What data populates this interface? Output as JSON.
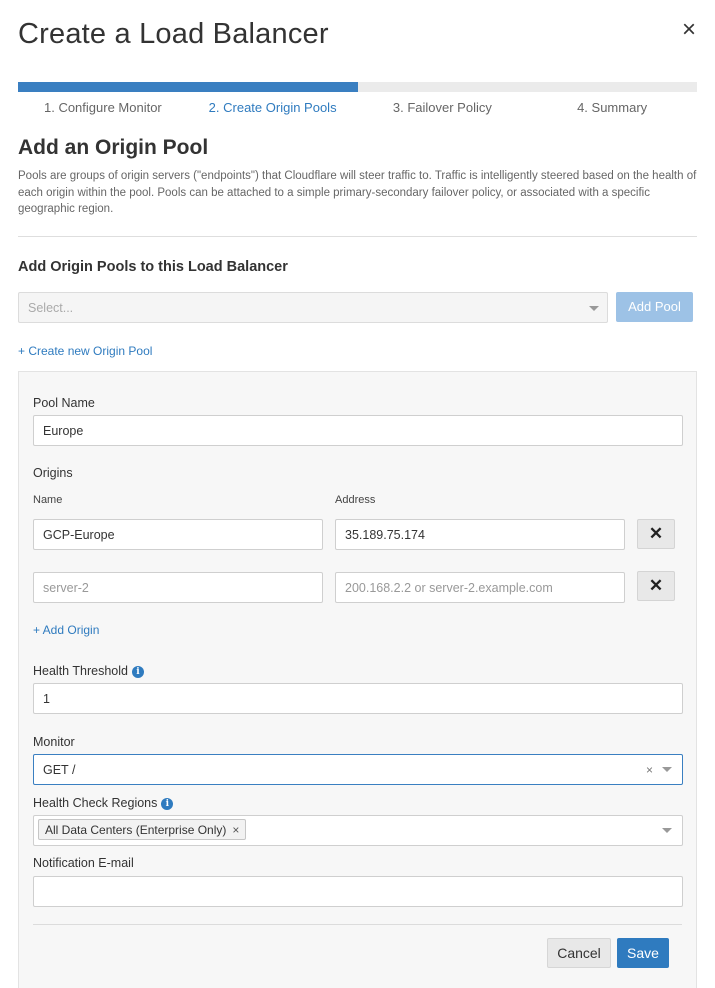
{
  "modal": {
    "title": "Create a Load Balancer",
    "close_glyph": "×"
  },
  "wizard": {
    "progress_fraction": 0.5,
    "steps": [
      {
        "label": "1. Configure Monitor",
        "active": false
      },
      {
        "label": "2. Create Origin Pools",
        "active": true
      },
      {
        "label": "3. Failover Policy",
        "active": false
      },
      {
        "label": "4. Summary",
        "active": false
      }
    ]
  },
  "section": {
    "title": "Add an Origin Pool",
    "description": "Pools are groups of origin servers (\"endpoints\") that Cloudflare will steer traffic to. Traffic is intelligently steered based on the health of each origin within the pool. Pools can be attached to a simple primary-secondary failover policy, or associated with a specific geographic region."
  },
  "add_pools": {
    "title": "Add Origin Pools to this Load Balancer",
    "select_placeholder": "Select...",
    "add_button": "Add Pool",
    "create_link": "+ Create new Origin Pool"
  },
  "pool_form": {
    "pool_name_label": "Pool Name",
    "pool_name_value": "Europe",
    "origins_label": "Origins",
    "name_col_label": "Name",
    "address_col_label": "Address",
    "origins": [
      {
        "name": "GCP-Europe",
        "address": "35.189.75.174",
        "name_placeholder": "",
        "address_placeholder": ""
      },
      {
        "name": "",
        "address": "",
        "name_placeholder": "server-2",
        "address_placeholder": "200.168.2.2 or server-2.example.com"
      }
    ],
    "remove_glyph": "✕",
    "add_origin_link": "+ Add Origin",
    "health_threshold_label": "Health Threshold",
    "health_threshold_value": "1",
    "monitor_label": "Monitor",
    "monitor_value": "GET /",
    "clear_glyph": "×",
    "health_regions_label": "Health Check Regions",
    "health_regions_tag": "All Data Centers (Enterprise Only)",
    "tag_remove_glyph": "×",
    "notification_label": "Notification E-mail",
    "notification_value": "",
    "info_glyph": "i"
  },
  "footer": {
    "cancel_label": "Cancel",
    "save_label": "Save"
  },
  "colors": {
    "accent": "#2f7bbf",
    "progress_track": "#ebebeb",
    "add_pool_disabled": "#9dc2e6"
  },
  "icons": [
    "close-icon",
    "chevron-down-icon",
    "info-icon",
    "remove-icon",
    "clear-icon"
  ]
}
